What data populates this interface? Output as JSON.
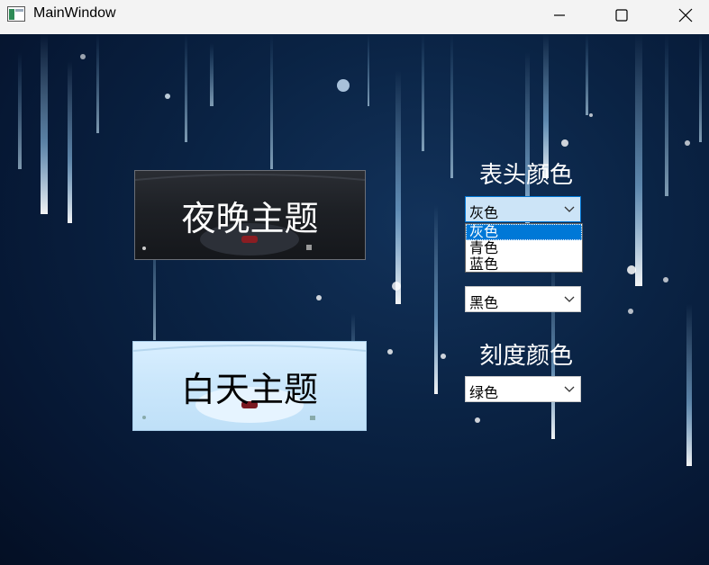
{
  "window": {
    "title": "MainWindow"
  },
  "themes": {
    "night_label": "夜晚主题",
    "day_label": "白天主题"
  },
  "header_color": {
    "label": "表头颜色",
    "selected": "灰色",
    "options": [
      "灰色",
      "青色",
      "蓝色"
    ]
  },
  "second_color": {
    "selected": "黑色"
  },
  "scale_color": {
    "label": "刻度颜色",
    "selected": "绿色"
  },
  "colors": {
    "background_dark": "#061733",
    "selection_blue": "#0078d7",
    "combo_open_bg": "#cce4f7"
  },
  "icons": {
    "app": "window-app-icon",
    "minimize": "minimize-icon",
    "maximize": "maximize-icon",
    "close": "close-icon",
    "dropdown": "chevron-down-icon"
  }
}
